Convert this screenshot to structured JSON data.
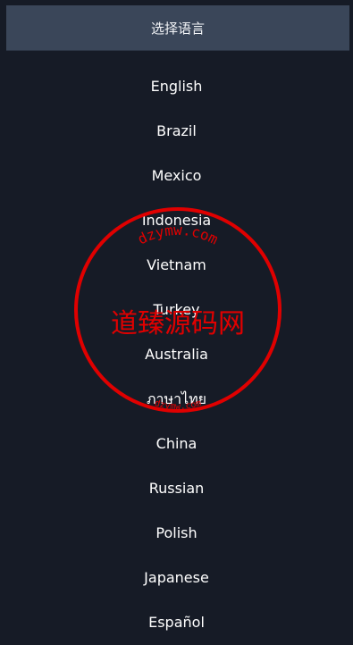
{
  "header": {
    "title": "选择语言"
  },
  "languages": [
    "English",
    "Brazil",
    "Mexico",
    "Indonesia",
    "Vietnam",
    "Turkey",
    "Australia",
    "ภาษาไทย",
    "China",
    "Russian",
    "Polish",
    "Japanese",
    "Español"
  ],
  "watermark": {
    "text_main": "道臻源码网",
    "text_ring": "dzymw.com",
    "color": "#e00000"
  },
  "colors": {
    "background": "#161b26",
    "header_bg": "#3a4659",
    "text": "#ffffff"
  }
}
